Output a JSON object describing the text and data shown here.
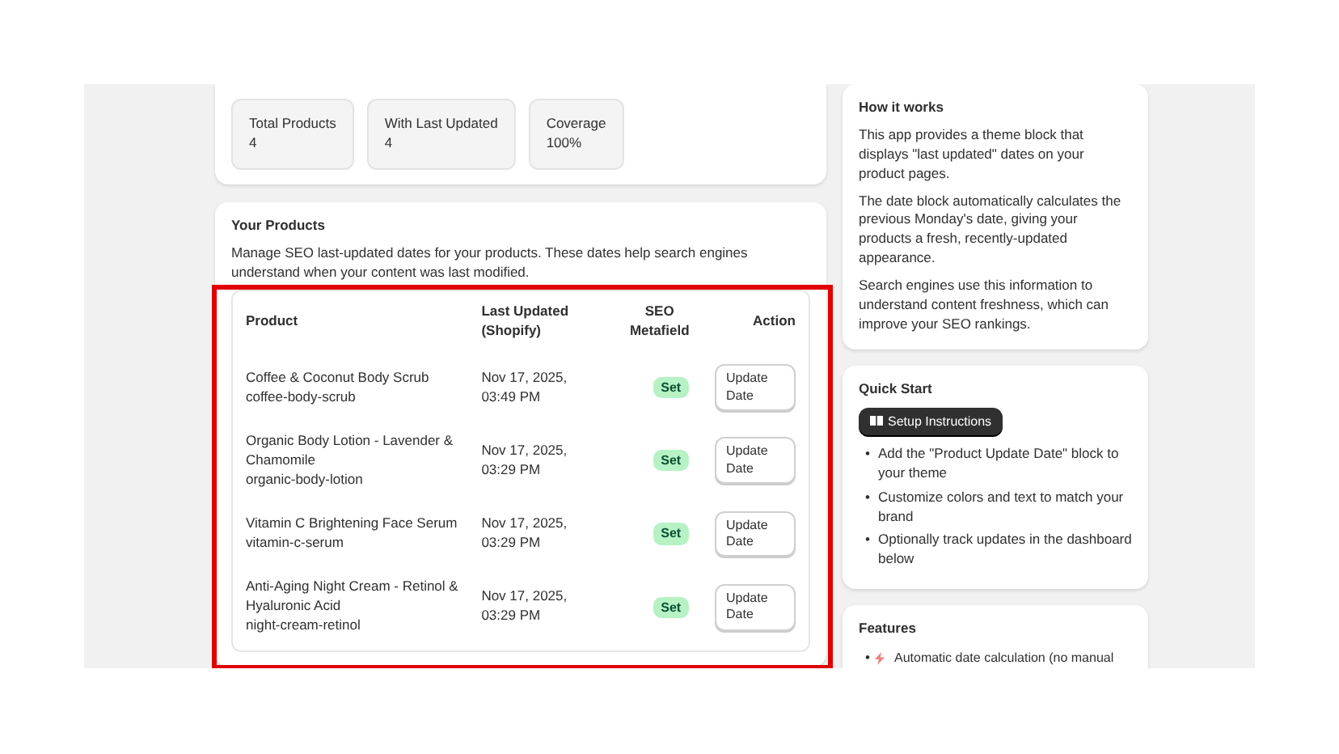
{
  "stats": [
    {
      "label": "Total Products",
      "value": "4"
    },
    {
      "label": "With Last Updated",
      "value": "4"
    },
    {
      "label": "Coverage",
      "value": "100%"
    }
  ],
  "products": {
    "title": "Your Products",
    "description": "Manage SEO last-updated dates for your products. These dates help search engines understand when your content was last modified.",
    "highlighted": true,
    "columns": [
      "Product",
      "Last Updated (Shopify)",
      "SEO Metafield",
      "Action"
    ],
    "rows": [
      {
        "name": "Coffee & Coconut Body Scrub",
        "handle": "coffee-body-scrub",
        "date": "Nov 17, 2025, 03:49 PM",
        "status": "Set",
        "action": "Update Date"
      },
      {
        "name": "Organic Body Lotion - Lavender & Chamomile",
        "handle": "organic-body-lotion",
        "date": "Nov 17, 2025, 03:29 PM",
        "status": "Set",
        "action": "Update Date"
      },
      {
        "name": "Vitamin C Brightening Face Serum",
        "handle": "vitamin-c-serum",
        "date": "Nov 17, 2025, 03:29 PM",
        "status": "Set",
        "action": "Update Date"
      },
      {
        "name": "Anti-Aging Night Cream - Retinol & Hyaluronic Acid",
        "handle": "night-cream-retinol",
        "date": "Nov 17, 2025, 03:29 PM",
        "status": "Set",
        "action": "Update Date"
      }
    ]
  },
  "how_it_works": {
    "title": "How it works",
    "paragraphs": [
      "This app provides a theme block that displays \"last updated\" dates on your product pages.",
      "The date block automatically calculates the previous Monday's date, giving your products a fresh, recently-updated appearance.",
      "Search engines use this information to understand content freshness, which can improve your SEO rankings."
    ]
  },
  "quick_start": {
    "title": "Quick Start",
    "bullet": "•",
    "button": "Setup Instructions",
    "steps": [
      "Add the \"Product Update Date\" block to your theme",
      "Customize colors and text to match your brand",
      "Optionally track updates in the dashboard below"
    ]
  },
  "features": {
    "title": "Features",
    "bullet": "•",
    "items": [
      "Automatic date calculation (no manual"
    ]
  }
}
